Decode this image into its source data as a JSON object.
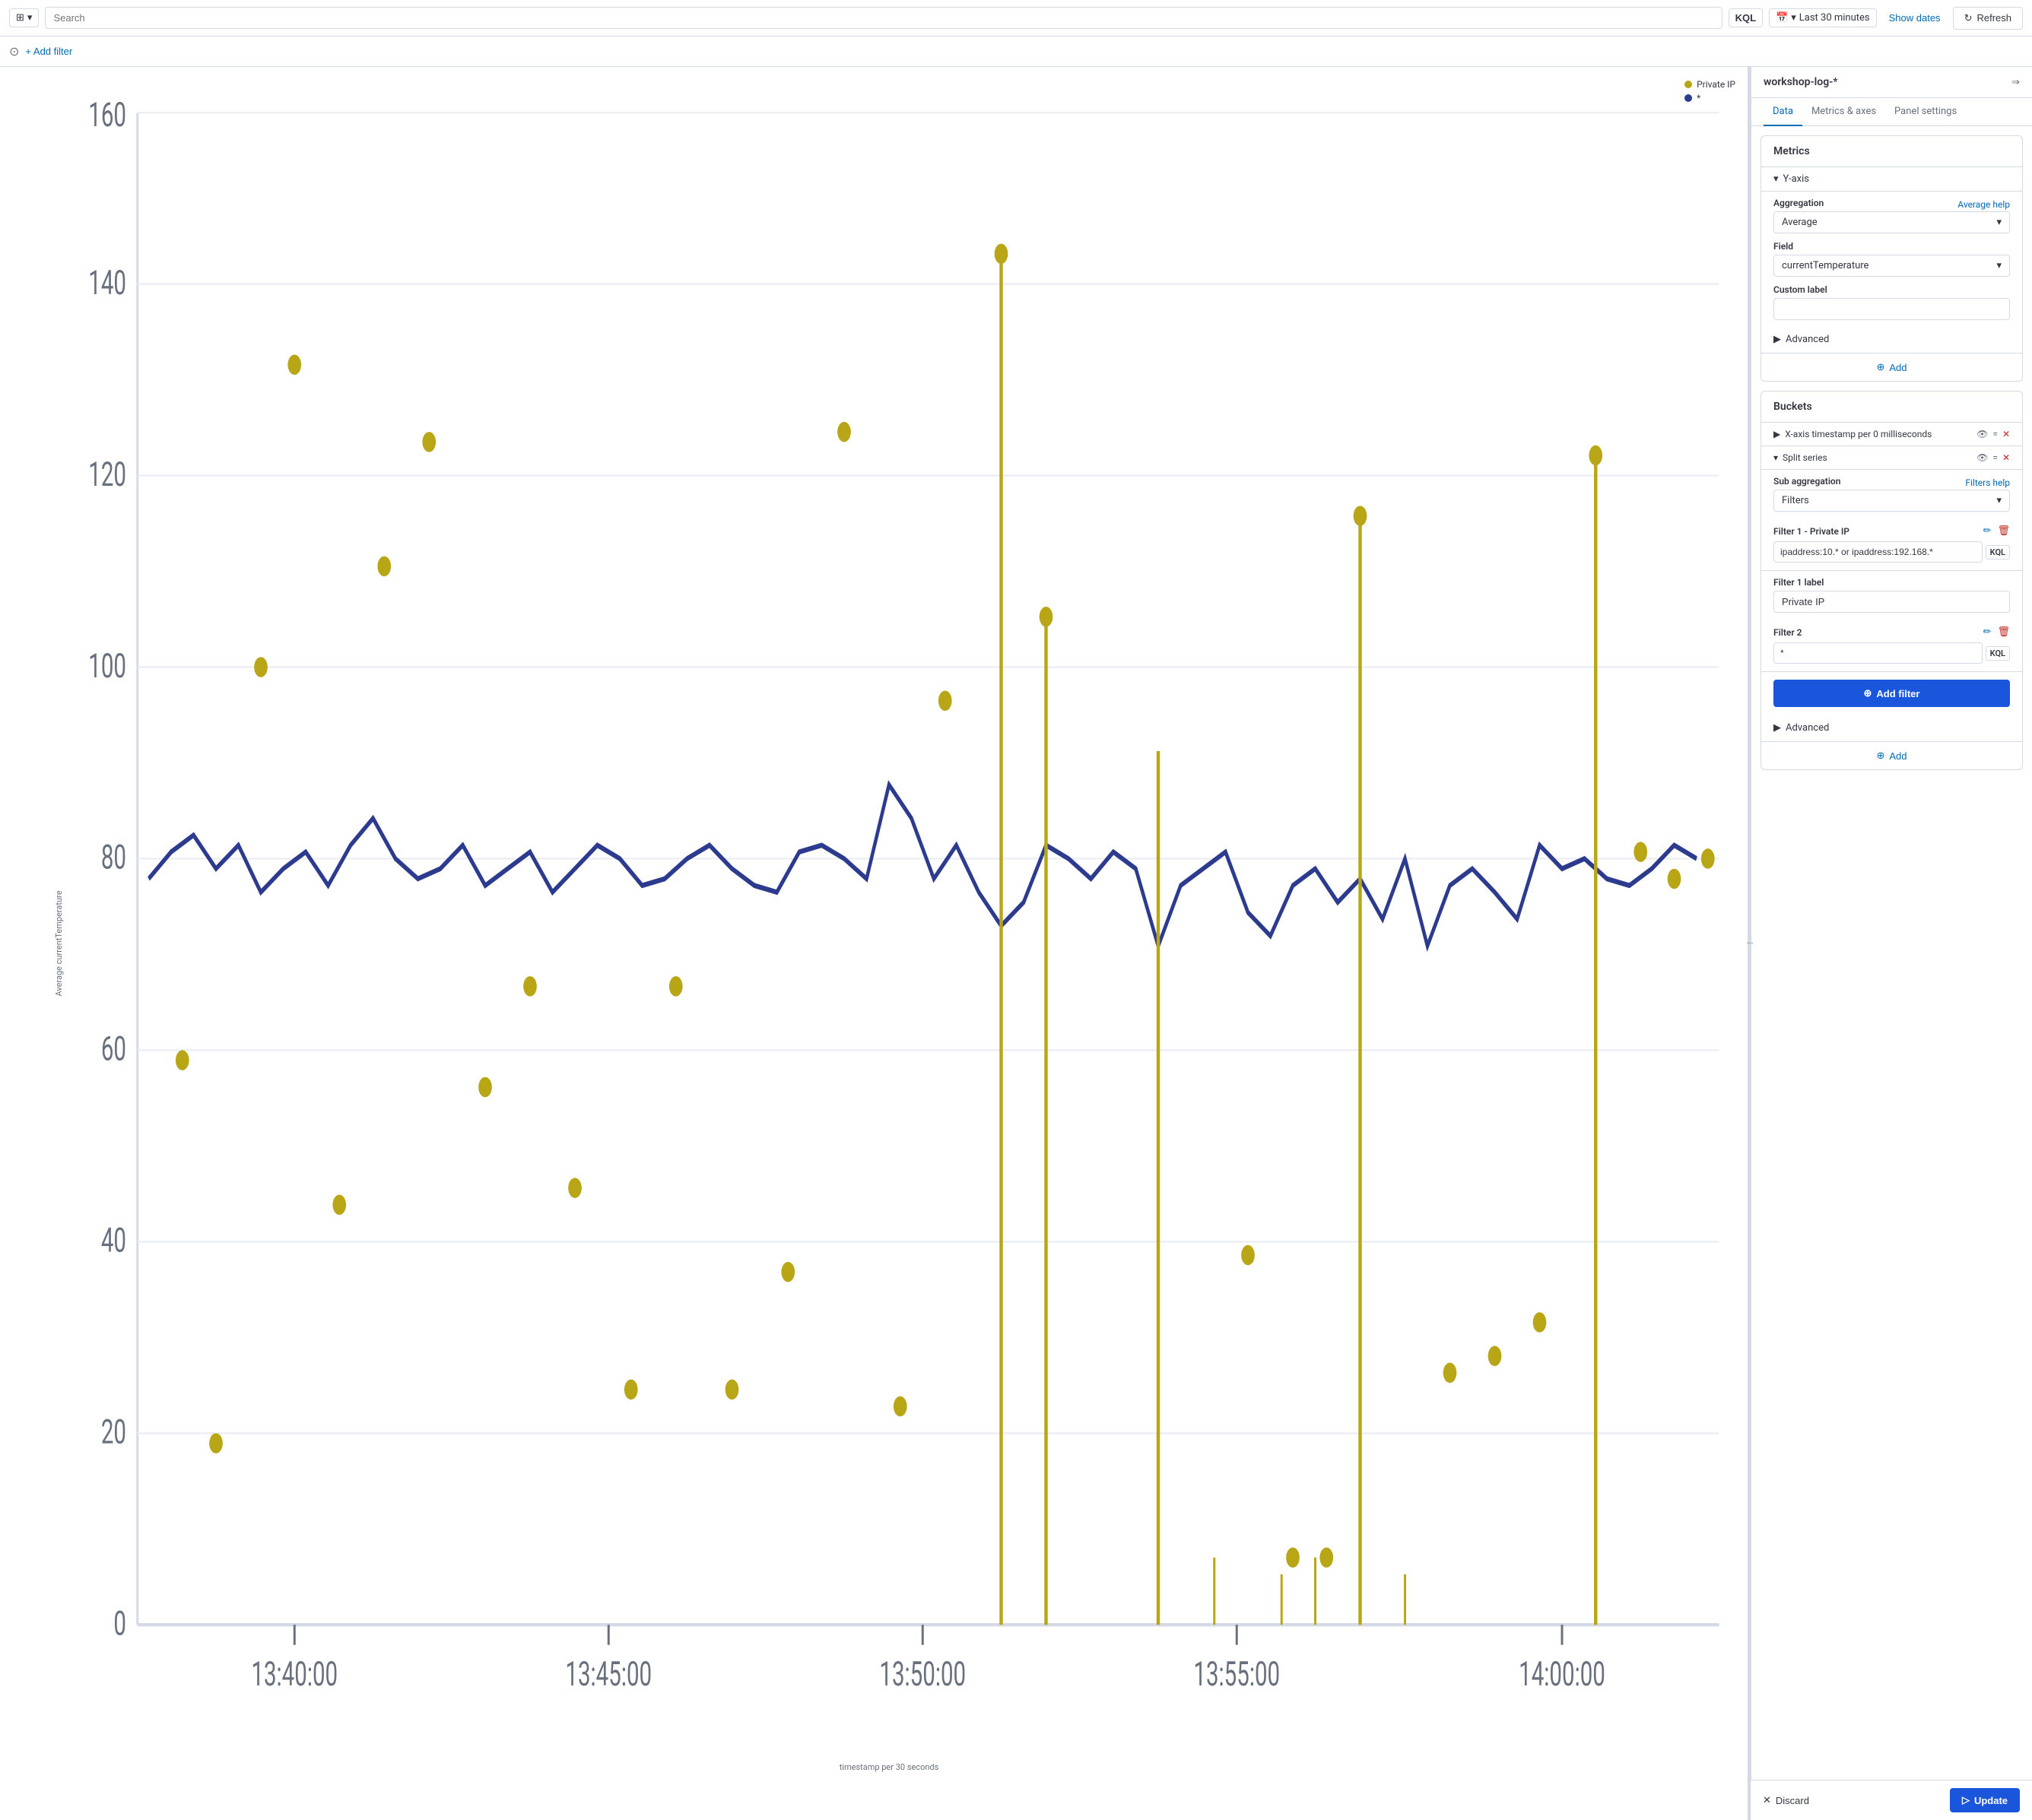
{
  "topbar": {
    "index_selector_label": "▼",
    "search_placeholder": "Search",
    "kql_label": "KQL",
    "calendar_icon": "📅",
    "time_range": "Last 30 minutes",
    "show_dates_label": "Show dates",
    "refresh_label": "Refresh"
  },
  "filterbar": {
    "add_filter_label": "+ Add filter"
  },
  "chart": {
    "y_axis_label": "Average currentTemperature",
    "x_axis_label": "timestamp per 30 seconds",
    "legend": [
      {
        "label": "Private IP",
        "color": "#b8a617"
      },
      {
        "label": "*",
        "color": "#2c3b8e"
      }
    ],
    "y_ticks": [
      "0",
      "20",
      "40",
      "60",
      "80",
      "100",
      "120",
      "140",
      "160"
    ],
    "x_ticks": [
      "13:40:00",
      "13:45:00",
      "13:50:00",
      "13:55:00",
      "14:00:00"
    ]
  },
  "panel": {
    "title": "workshop-log-*",
    "expand_icon": "⇒",
    "tabs": [
      {
        "label": "Data",
        "active": true
      },
      {
        "label": "Metrics & axes",
        "active": false
      },
      {
        "label": "Panel settings",
        "active": false
      }
    ],
    "metrics_section": {
      "title": "Metrics",
      "y_axis_label": "Y-axis",
      "aggregation_label": "Aggregation",
      "aggregation_help": "Average help",
      "aggregation_value": "Average",
      "field_label": "Field",
      "field_value": "currentTemperature",
      "custom_label_label": "Custom label",
      "custom_label_value": "",
      "advanced_label": "Advanced",
      "add_label": "Add"
    },
    "buckets_section": {
      "title": "Buckets",
      "xaxis_row": "X-axis  timestamp per 0 milliseconds",
      "split_series_row": "Split series",
      "sub_aggregation_label": "Sub aggregation",
      "sub_aggregation_help": "Filters help",
      "sub_aggregation_value": "Filters",
      "filter1_label": "Filter 1 - Private IP",
      "filter1_value": "ipaddress:10.* or ipaddress:192.168.*",
      "filter1_kql": "KQL",
      "filter1_text_label": "Filter 1 label",
      "filter1_text_value": "Private IP",
      "filter2_label": "Filter 2",
      "filter2_value": "*",
      "filter2_kql": "KQL",
      "advanced_label": "Advanced",
      "add_filter_label": "Add filter",
      "add_label": "Add"
    }
  },
  "bottombar": {
    "discard_label": "Discard",
    "update_label": "Update"
  }
}
